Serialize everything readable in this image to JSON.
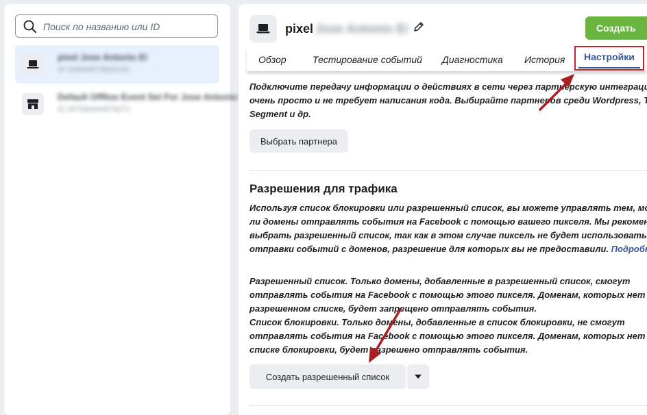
{
  "sidebar": {
    "search_placeholder": "Поиск по названию или ID",
    "items": [
      {
        "name": "pixel Jose Antonio Ei",
        "id": "ID 306668578826181",
        "icon": "laptop-icon"
      },
      {
        "name": "Default Offline Event Set For Jose Antonio El",
        "id": "ID 357080644878371",
        "icon": "store-icon"
      }
    ]
  },
  "header": {
    "title": "pixel",
    "title_blurred": "Jose Antonio Ei",
    "create_label": "Создать"
  },
  "tabs": [
    {
      "label": "Обзор"
    },
    {
      "label": "Тестирование событий"
    },
    {
      "label": "Диагностика"
    },
    {
      "label": "История"
    },
    {
      "label": "Настройки"
    }
  ],
  "partner": {
    "line1": "Подключите передачу информации о действиях в сети через партнерскую интеграцию. Э",
    "line2": "очень просто и не требует написания кода. Выбирайте партнеров среди Wordpress, Tealiu",
    "line3": "Segment и др.",
    "button": "Выбрать партнера"
  },
  "traffic": {
    "heading": "Разрешения для трафика",
    "line1": "Используя список блокировки или разрешенный список, вы можете управлять тем, могу",
    "line2": "ли домены отправлять события на Facebook с помощью вашего пикселя. Мы рекоменду",
    "line3": "выбрать разрешенный список, так как в этом случае пиксель не будет использоваться д",
    "line4": "отправки событий с доменов, разрешение для которых вы не предоставили.",
    "more_link": "Подробнее",
    "allow_line1": "Разрешенный список. Только домены, добавленные в разрешенный список, смогут",
    "allow_line2": "отправлять события на Facebook с помощью этого пикселя. Доменам, которых нет в",
    "allow_line3": "разрешенном списке, будет запрещено отправлять события.",
    "block_line1": "Список блокировки. Только домены, добавленные в список блокировки, не смогут",
    "block_line2": "отправлять события на Facebook с помощью этого пикселя. Доменам, которых нет в",
    "block_line3": "списке блокировки, будет разрешено отправлять события.",
    "create_button": "Создать разрешенный список"
  },
  "colors": {
    "accent": "#385898",
    "create": "#69b540",
    "highlight": "#c0272d"
  }
}
